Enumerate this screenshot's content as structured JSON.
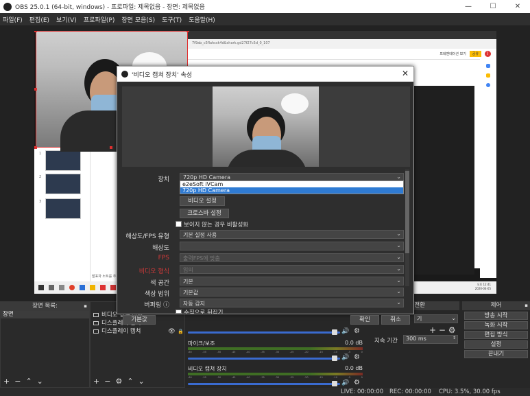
{
  "window": {
    "title": "OBS 25.0.1 (64-bit, windows) - 프로파일: 제목없음 - 장면: 제목없음",
    "minimize": "—",
    "maximize": "☐",
    "close": "✕"
  },
  "menu": [
    "파일(F)",
    "편집(E)",
    "보기(V)",
    "프로파일(P)",
    "장면 모음(S)",
    "도구(T)",
    "도움말(H)"
  ],
  "preview_content": {
    "url_text": "7f9ab_c5flahcsk4d&shark.gd27f27c5d_0_107",
    "toolbar_text": "프레젠테이션 보기",
    "share_label": "공유",
    "avatar": "J",
    "slide_nums": [
      "1",
      "2",
      "3"
    ],
    "notes_text": "발표자 노트를 추가하려면 클릭하세요.",
    "taskbar_time": "오후 12:41",
    "taskbar_date": "2020-04-05"
  },
  "dialog": {
    "title": "'비디오 캡쳐 장치' 속성",
    "close": "✕",
    "device_label": "장치",
    "device_value": "720p HD Camera",
    "device_options": [
      "e2eSoft iVCam",
      "720p HD Camera"
    ],
    "device_selected": "720p HD Camera",
    "video_settings_button": "비디오 설정",
    "crossbar_settings_button": "크로스바 설정",
    "deactivate_checkbox": "보이지 않는 경우 비활성화",
    "rows": [
      {
        "label": "해상도/FPS 유형",
        "value": "기본 설정 사용",
        "dim": false,
        "red": false
      },
      {
        "label": "해상도",
        "value": "",
        "dim": false,
        "red": false
      },
      {
        "label": "FPS",
        "value": "출력FPS에 맞춤",
        "dim": true,
        "red": true
      },
      {
        "label": "비디오 형식",
        "value": "임의",
        "dim": true,
        "red": true
      },
      {
        "label": "색 공간",
        "value": "기본",
        "dim": false,
        "red": false
      },
      {
        "label": "색상 범위",
        "value": "기본값",
        "dim": false,
        "red": false
      },
      {
        "label": "버퍼링",
        "value": "자동 감지",
        "dim": false,
        "red": false
      }
    ],
    "flip_checkbox": "수직으로 뒤집기",
    "defaults_button": "기본값",
    "ok_button": "확인",
    "cancel_button": "취소"
  },
  "scenes_dock": {
    "title": "장면 목록:",
    "items": [
      "장면"
    ]
  },
  "sources_dock": {
    "items": [
      "비디오 캡쳐 장치",
      "디스플레이 캡쳐",
      "디스플레이 캡쳐"
    ]
  },
  "mixer": {
    "tracks": [
      {
        "name": "마이크/보조",
        "db": "0.0 dB"
      },
      {
        "name": "비디오 캡쳐 장치",
        "db": "0.0 dB"
      }
    ],
    "ticks": [
      "-60",
      "-55",
      "-50",
      "-45",
      "-40",
      "-35",
      "-30",
      "-25",
      "-20",
      "-15",
      "-10",
      "-5",
      "0"
    ]
  },
  "transitions_dock": {
    "title": "전환",
    "select_value": "기",
    "duration_label": "지속 기간",
    "duration_value": "300 ms"
  },
  "controls_dock": {
    "title": "제어",
    "buttons": [
      "방송 시작",
      "녹화 시작",
      "편집 방식",
      "설정",
      "끝내기"
    ]
  },
  "status": {
    "live": "LIVE: 00:00:00",
    "rec": "REC: 00:00:00",
    "cpu": "CPU: 3.5%, 30.00 fps"
  }
}
